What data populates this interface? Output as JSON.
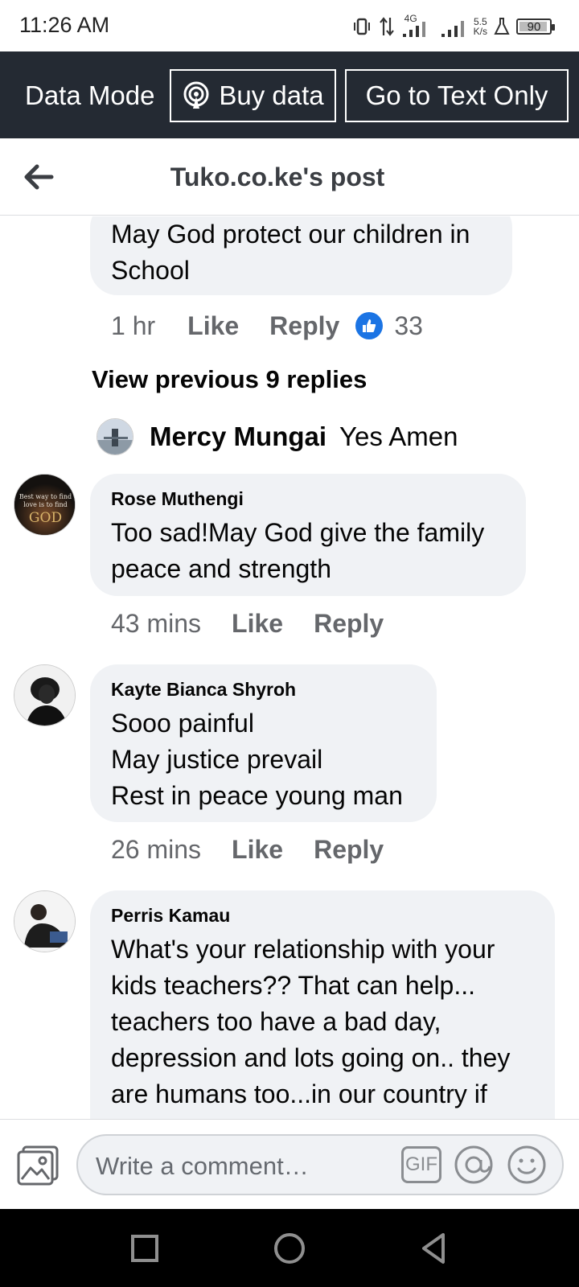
{
  "status_bar": {
    "time": "11:26 AM",
    "network_type": "4G",
    "speed_value": "5.5",
    "speed_unit": "K/s",
    "battery_level": "90"
  },
  "data_bar": {
    "mode_label": "Data Mode",
    "buy_data_label": "Buy data",
    "text_only_label": "Go to Text Only"
  },
  "header": {
    "title": "Tuko.co.ke's post"
  },
  "comments": {
    "top": {
      "text_line1": "May God protect our children in",
      "text_line2": "School",
      "time": "1 hr",
      "like_label": "Like",
      "reply_label": "Reply",
      "reaction_count": "33"
    },
    "view_previous": "View previous 9 replies",
    "reply": {
      "author": "Mercy Mungai",
      "text": "Yes Amen"
    },
    "items": [
      {
        "author": "Rose Muthengi",
        "lines": [
          "Too sad!May God give the family",
          "peace and strength"
        ],
        "time": "43 mins",
        "like_label": "Like",
        "reply_label": "Reply",
        "avatar_text": [
          "Best way to find",
          "love is to find",
          "GOD"
        ]
      },
      {
        "author": "Kayte Bianca Shyroh",
        "lines": [
          "Sooo painful",
          "May justice prevail",
          "Rest in peace young man"
        ],
        "time": "26 mins",
        "like_label": "Like",
        "reply_label": "Reply"
      },
      {
        "author": "Perris Kamau",
        "lines": [
          "What's your relationship with your",
          "kids teachers?? That can help...",
          "teachers too have a bad day,",
          "depression and lots going on.. they",
          "are humans too...in our country if"
        ]
      }
    ]
  },
  "composer": {
    "placeholder": "Write a comment…",
    "gif_label": "GIF"
  },
  "colors": {
    "data_bar_bg": "#242a33",
    "bubble_bg": "#f0f2f5",
    "like_blue": "#1b74e4",
    "meta_gray": "#65676b"
  }
}
